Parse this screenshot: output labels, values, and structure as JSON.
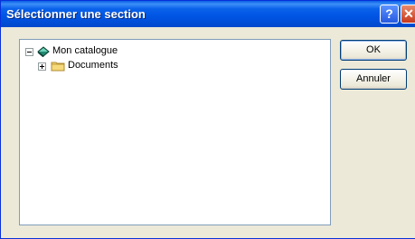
{
  "window": {
    "title": "Sélectionner une section"
  },
  "titlebar": {
    "help_glyph": "?",
    "close_glyph": "✕"
  },
  "tree": {
    "items": [
      {
        "label": "Mon catalogue",
        "expanded": true,
        "icon": "book-icon"
      },
      {
        "label": "Documents",
        "expanded": false,
        "icon": "folder-icon"
      }
    ]
  },
  "buttons": {
    "ok_label": "OK",
    "cancel_label": "Annuler"
  }
}
